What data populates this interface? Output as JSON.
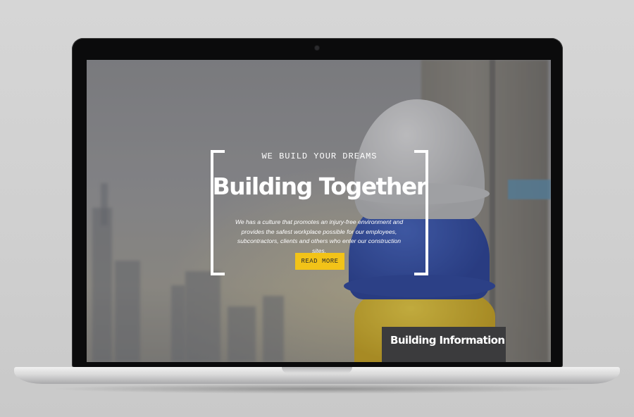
{
  "hero": {
    "tagline": "WE BUILD YOUR DREAMS",
    "headline": "Building Together",
    "description": "We has a culture that promotes an injury-free environment and provides the safest workplace possible for our employees, subcontractors, clients and others who enter our construction sites.",
    "cta_label": "READ MORE"
  },
  "info_panel": {
    "title": "Building Information"
  },
  "colors": {
    "accent_yellow": "#f2c318",
    "panel_dark": "#3b3b3d",
    "laptop_bezel": "#0b0b0c"
  }
}
